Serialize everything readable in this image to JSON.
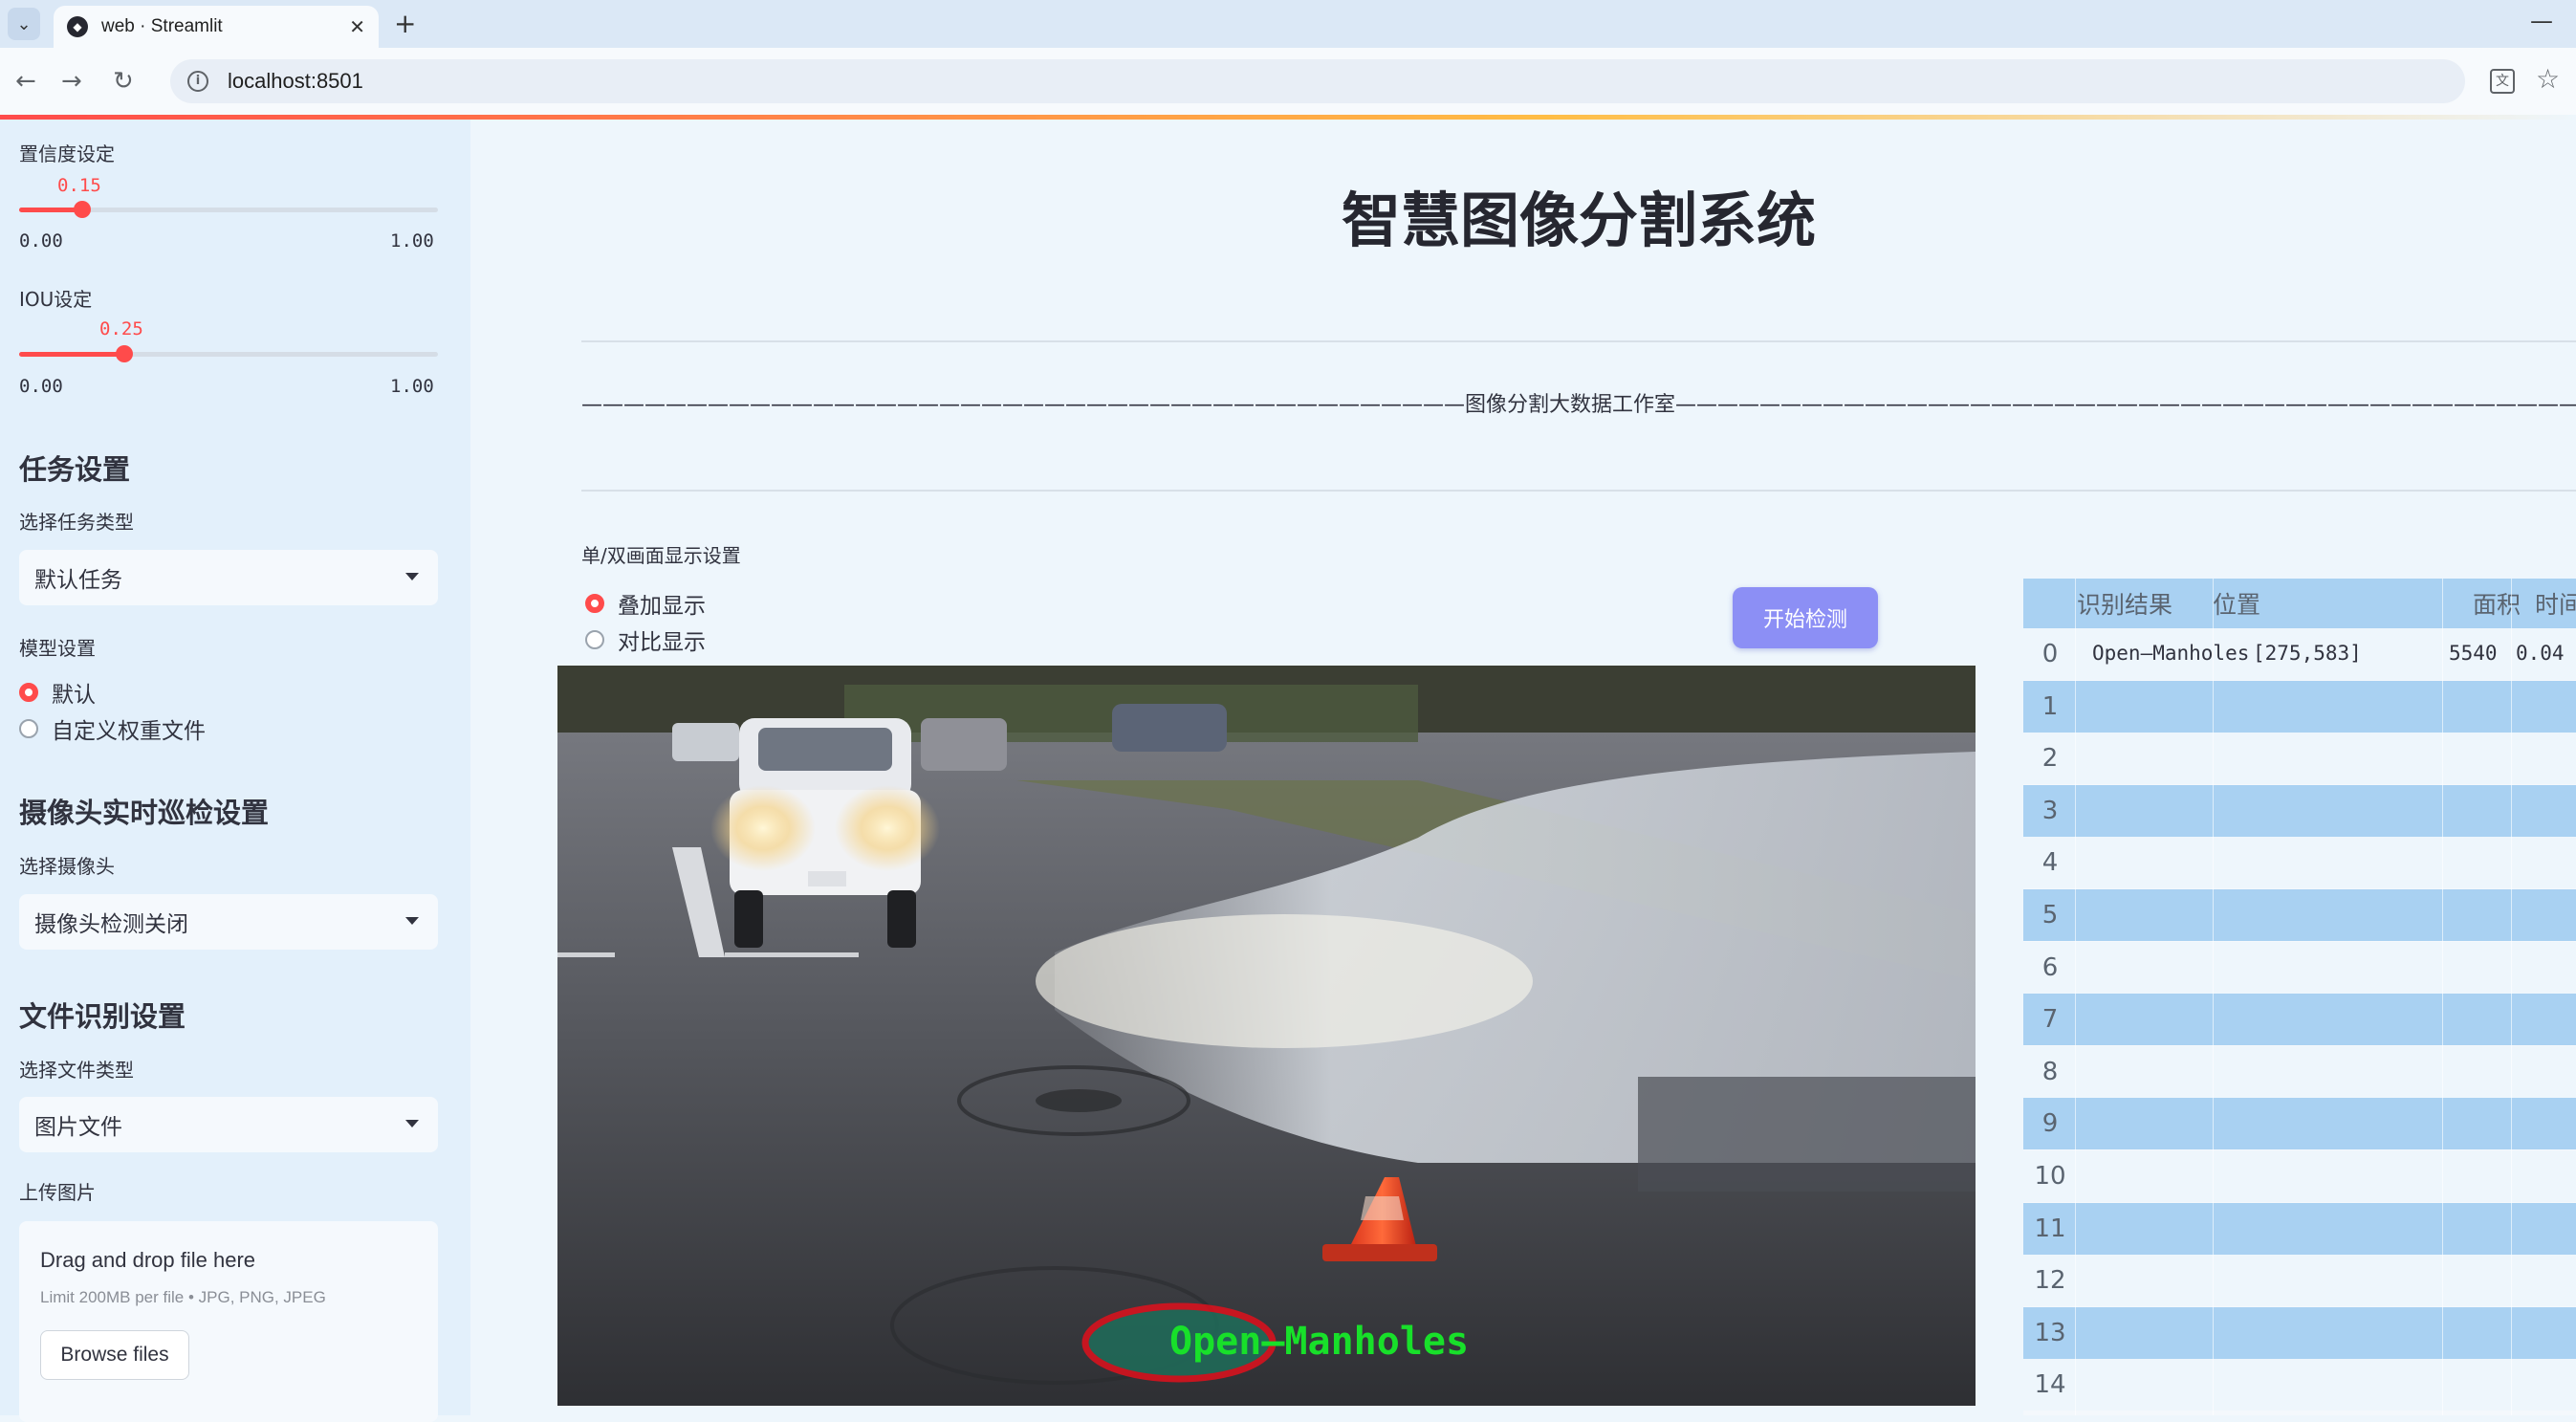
{
  "browser": {
    "tab_title": "web · Streamlit",
    "url": "localhost:8501"
  },
  "sidebar": {
    "confidence": {
      "label": "置信度设定",
      "value_text": "0.15",
      "value": 0.15,
      "min": "0.00",
      "max": "1.00"
    },
    "iou": {
      "label": "IOU设定",
      "value_text": "0.25",
      "value": 0.25,
      "min": "0.00",
      "max": "1.00"
    },
    "task_header": "任务设置",
    "task_type_label": "选择任务类型",
    "task_type_value": "默认任务",
    "model_label": "模型设置",
    "model_options": [
      "默认",
      "自定义权重文件"
    ],
    "camera_header": "摄像头实时巡检设置",
    "camera_label": "选择摄像头",
    "camera_value": "摄像头检测关闭",
    "file_header": "文件识别设置",
    "file_type_label": "选择文件类型",
    "file_type_value": "图片文件",
    "upload_label": "上传图片",
    "upload": {
      "title": "Drag and drop file here",
      "limit": "Limit 200MB per file • JPG, PNG, JPEG",
      "button": "Browse files"
    }
  },
  "main": {
    "title": "智慧图像分割系统",
    "studio_line": "——————————————————————————————————————————图像分割大数据工作室————————————————————————————————————————————————",
    "display_label": "单/双画面显示设置",
    "display_options": [
      "叠加显示",
      "对比显示"
    ],
    "start_button": "开始检测",
    "detection_label": "Open—Manholes"
  },
  "table": {
    "headers": [
      "识别结果",
      "位置",
      "面积",
      "时间"
    ],
    "rows": [
      {
        "index": "0",
        "result": "Open—Manholes",
        "position": "[275,583]",
        "area": "5540",
        "time": "0.04"
      },
      {
        "index": "1"
      },
      {
        "index": "2"
      },
      {
        "index": "3"
      },
      {
        "index": "4"
      },
      {
        "index": "5"
      },
      {
        "index": "6"
      },
      {
        "index": "7"
      },
      {
        "index": "8"
      },
      {
        "index": "9"
      },
      {
        "index": "10"
      },
      {
        "index": "11"
      },
      {
        "index": "12"
      },
      {
        "index": "13"
      },
      {
        "index": "14"
      }
    ]
  },
  "colors": {
    "accent": "#ff4b4b",
    "button": "#8c8ff5",
    "table_stripe": "#a9d1f2",
    "detection": "#18e02a",
    "mask_outline": "#e0101c"
  }
}
